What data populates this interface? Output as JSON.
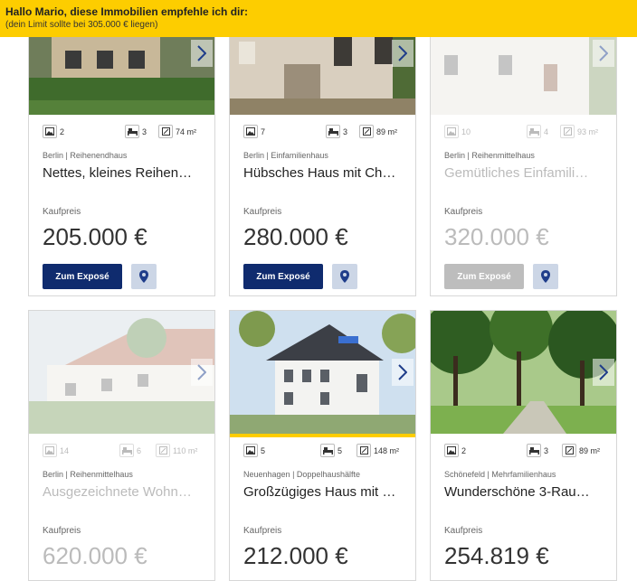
{
  "banner": {
    "greeting": "Hallo Mario, diese Immobilien empfehle ich dir:",
    "limit_note": "(dein Limit sollte bei 305.000 € liegen)"
  },
  "price_label": "Kaufpreis",
  "expose_label": "Zum Exposé",
  "area_unit": "m²",
  "icons": {
    "photos": "image-icon",
    "rooms": "bed-icon",
    "area": "area-icon",
    "map": "map-pin-icon",
    "next": "chevron-right-icon"
  },
  "colors": {
    "banner": "#fdcd00",
    "primary_button": "#0f2b6e",
    "map_button": "#ccd6e6",
    "highlight_stripe": "#fdcd00"
  },
  "listings": [
    {
      "photos": "2",
      "rooms": "3",
      "area": "74 m²",
      "city": "Berlin",
      "type": "Reihenendhaus",
      "title": "Nettes, kleines Reihen…",
      "price": "205.000 €",
      "dimmed": false
    },
    {
      "photos": "7",
      "rooms": "3",
      "area": "89 m²",
      "city": "Berlin",
      "type": "Einfamilienhaus",
      "title": "Hübsches Haus mit Ch…",
      "price": "280.000 €",
      "dimmed": false
    },
    {
      "photos": "10",
      "rooms": "4",
      "area": "93 m²",
      "city": "Berlin",
      "type": "Reihenmittelhaus",
      "title": "Gemütliches Einfamili…",
      "price": "320.000 €",
      "dimmed": true
    },
    {
      "photos": "14",
      "rooms": "6",
      "area": "110 m²",
      "city": "Berlin",
      "type": "Reihenmittelhaus",
      "title": "Ausgezeichnete Wohn…",
      "price": "620.000 €",
      "dimmed": true
    },
    {
      "photos": "5",
      "rooms": "5",
      "area": "148 m²",
      "city": "Neuenhagen",
      "type": "Doppelhaushälfte",
      "title": "Großzügiges Haus mit …",
      "price": "212.000 €",
      "dimmed": false
    },
    {
      "photos": "2",
      "rooms": "3",
      "area": "89 m²",
      "city": "Schönefeld",
      "type": "Mehrfamilienhaus",
      "title": "Wunderschöne 3-Rau…",
      "price": "254.819 €",
      "dimmed": false
    }
  ]
}
